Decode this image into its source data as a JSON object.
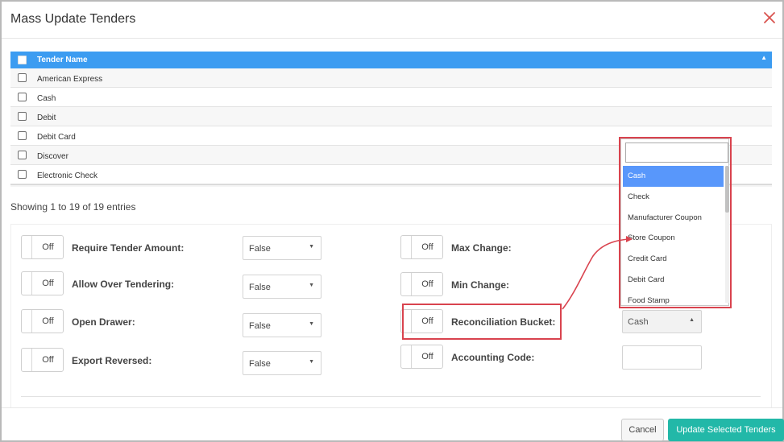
{
  "modal": {
    "title": "Mass Update Tenders",
    "close_icon": "close-icon",
    "accent_close": "#d9534f"
  },
  "table": {
    "header": "Tender Name",
    "rows": [
      "American Express",
      "Cash",
      "Debit",
      "Debit Card",
      "Discover",
      "Electronic Check"
    ],
    "header_color": "#3c9cf1"
  },
  "showing": "Showing 1 to 19 of 19 entries",
  "settings": {
    "left": [
      {
        "toggle": "Off",
        "label": "Require Tender Amount:",
        "value": "False"
      },
      {
        "toggle": "Off",
        "label": "Allow Over Tendering:",
        "value": "False"
      },
      {
        "toggle": "Off",
        "label": "Open Drawer:",
        "value": "False"
      },
      {
        "toggle": "Off",
        "label": "Export Reversed:",
        "value": "False"
      }
    ],
    "right": [
      {
        "toggle": "Off",
        "label": "Max Change:"
      },
      {
        "toggle": "Off",
        "label": "Min Change:"
      },
      {
        "toggle": "Off",
        "label": "Reconciliation Bucket:",
        "value": "Cash"
      },
      {
        "toggle": "Off",
        "label": "Accounting Code:",
        "value": ""
      }
    ]
  },
  "dropdown": {
    "search_value": "",
    "options": [
      "Cash",
      "Check",
      "Manufacturer Coupon",
      "Store Coupon",
      "Credit Card",
      "Debit Card",
      "Food Stamp"
    ],
    "selected": "Cash",
    "highlight_color": "#5897fb"
  },
  "footer": {
    "cancel": "Cancel",
    "update": "Update Selected Tenders",
    "update_color": "#22b8a8"
  },
  "annotation_color": "#d9434e"
}
